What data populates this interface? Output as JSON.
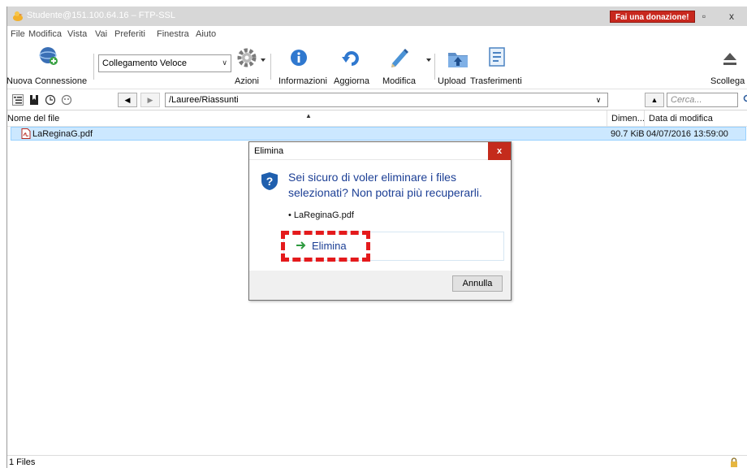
{
  "window": {
    "title": "Studente@151.100.64.16 – FTP-SSL",
    "donate_label": "Fai una donazione!",
    "minimize_glyph": "▫",
    "close_glyph": "x"
  },
  "menu": [
    "File",
    "Modifica",
    "Vista",
    "Vai",
    "Preferiti",
    "Finestra",
    "Aiuto"
  ],
  "toolbar": {
    "new_connection": "Nuova Connessione",
    "quick_connect_value": "Collegamento Veloce",
    "actions": "Azioni",
    "info": "Informazioni",
    "refresh": "Aggiorna",
    "edit": "Modifica",
    "upload": "Upload",
    "transfers": "Trasferimenti",
    "disconnect": "Scollega"
  },
  "pathbar": {
    "path_value": "/Lauree/Riassunti",
    "search_placeholder": "Cerca...",
    "back_glyph": "◀",
    "forward_glyph": "▶",
    "up_glyph": "▲",
    "dropdown_glyph": "∨"
  },
  "file_list": {
    "columns": [
      "Nome del file",
      "Dimen...",
      "Data di modifica"
    ],
    "rows": [
      {
        "name": "LaReginaG.pdf",
        "size": "90.7 KiB",
        "modified": "04/07/2016 13:59:00"
      }
    ]
  },
  "status": {
    "text": "1 Files"
  },
  "dialog": {
    "title": "Elimina",
    "close_glyph": "x",
    "message": "Sei sicuro di voler eliminare i files selezionati? Non potrai più recuperarli.",
    "file_item": "• LaReginaG.pdf",
    "delete_label": "Elimina",
    "cancel_label": "Annulla"
  },
  "colors": {
    "accent_blue": "#1c3f95",
    "selection": "#cce8ff",
    "danger": "#c42b1c",
    "highlight": "#e41a1c"
  }
}
